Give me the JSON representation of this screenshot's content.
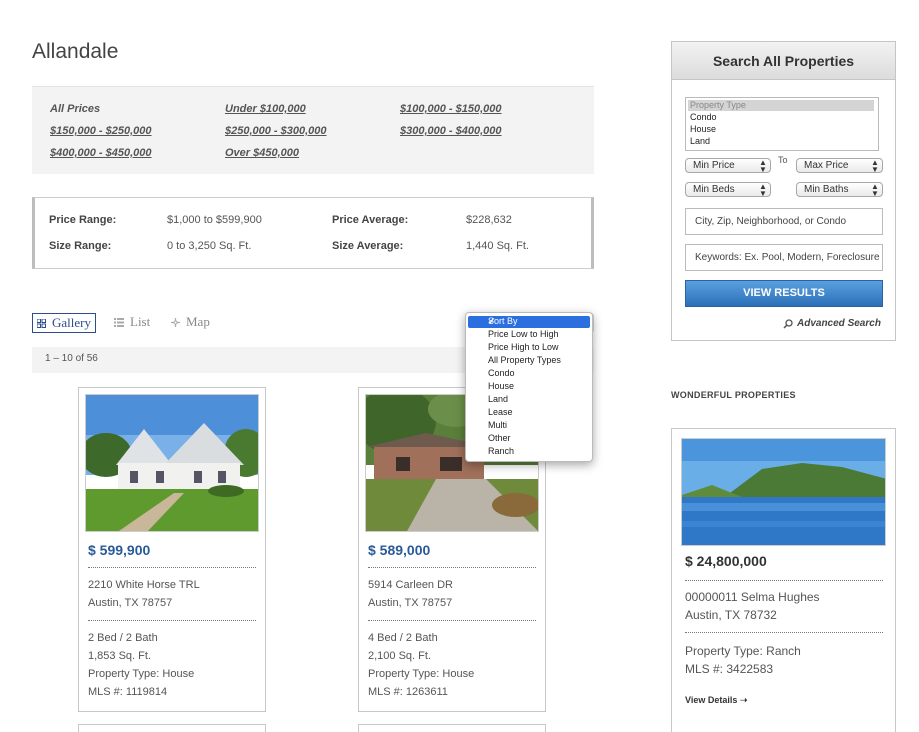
{
  "page": {
    "title": "Allandale"
  },
  "price_filters": [
    "All Prices",
    "Under $100,000",
    "$100,000 - $150,000",
    "$150,000 - $250,000",
    "$250,000 - $300,000",
    "$300,000 - $400,000",
    "$400,000 - $450,000",
    "Over $450,000"
  ],
  "stats": {
    "price_range_label": "Price Range:",
    "price_range_value": "$1,000 to $599,900",
    "price_avg_label": "Price Average:",
    "price_avg_value": "$228,632",
    "size_range_label": "Size Range:",
    "size_range_value": "0 to 3,250 Sq. Ft.",
    "size_avg_label": "Size Average:",
    "size_avg_value": "1,440 Sq. Ft."
  },
  "views": {
    "gallery": "Gallery",
    "list": "List",
    "map": "Map",
    "active": "gallery"
  },
  "results": {
    "count_text": "1 – 10 of 56"
  },
  "sort": {
    "selected": "Sort By",
    "options": [
      "Price Low to High",
      "Price High to Low",
      "All Property Types",
      "Condo",
      "House",
      "Land",
      "Lease",
      "Multi",
      "Other",
      "Ranch"
    ]
  },
  "listings": [
    {
      "price": "$ 599,900",
      "address": "2210 White Horse TRL",
      "city": "Austin, TX 78757",
      "beds_baths": "2 Bed / 2 Bath",
      "sqft": "1,853 Sq. Ft.",
      "type": "Property Type: House",
      "mls": "MLS #: 1119814"
    },
    {
      "price": "$ 589,000",
      "address": "5914 Carleen DR",
      "city": "Austin, TX 78757",
      "beds_baths": "4 Bed / 2 Bath",
      "sqft": "2,100 Sq. Ft.",
      "type": "Property Type: House",
      "mls": "MLS #: 1263611"
    }
  ],
  "search": {
    "title": "Search All Properties",
    "property_type_placeholder": "Property Type",
    "property_types": [
      "Condo",
      "House",
      "Land"
    ],
    "min_price": "Min Price",
    "to_label": "To",
    "max_price": "Max Price",
    "min_beds": "Min Beds",
    "min_baths": "Min Baths",
    "location_placeholder": "City, Zip, Neighborhood, or Condo",
    "keywords_placeholder": "Keywords: Ex. Pool, Modern, Foreclosure",
    "submit": "VIEW RESULTS",
    "advanced": "Advanced Search"
  },
  "featured": {
    "heading": "WONDERFUL PROPERTIES",
    "price": "$ 24,800,000",
    "address": "00000011 Selma Hughes",
    "city": "Austin, TX 78732",
    "type": "Property Type: Ranch",
    "mls": "MLS #: 3422583",
    "details": "View Details"
  },
  "colors": {
    "accent_blue": "#2a5a9a",
    "button_blue": "#2c6fb8",
    "menu_highlight": "#2b6ee0"
  },
  "icons": {
    "gallery": "grid-icon",
    "list": "list-icon",
    "map": "map-icon",
    "search": "magnifier-icon",
    "arrow": "arrow-right-icon"
  }
}
